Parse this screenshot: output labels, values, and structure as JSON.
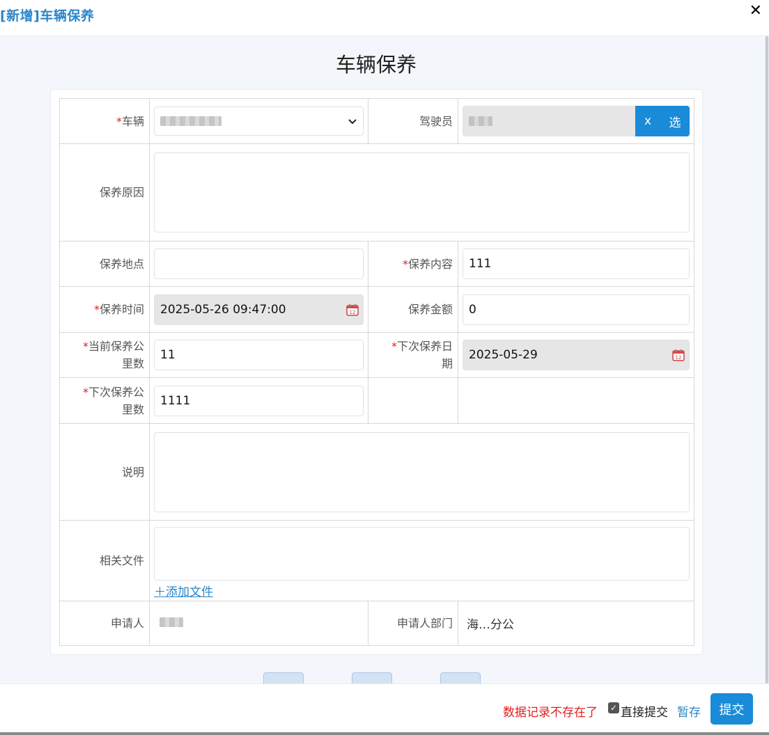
{
  "dialog": {
    "title": "[新增]车辆保养",
    "close_glyph": "✕"
  },
  "form": {
    "heading": "车辆保养",
    "required_mark": "*",
    "labels": {
      "vehicle": "车辆",
      "driver": "驾驶员",
      "reason": "保养原因",
      "location": "保养地点",
      "content": "保养内容",
      "time": "保养时间",
      "amount": "保养金额",
      "current_km_1": "当前保养公",
      "current_km_2": "里数",
      "next_date_1": "下次保养日",
      "next_date_2": "期",
      "next_km_1": "下次保养公",
      "next_km_2": "里数",
      "note": "说明",
      "files": "相关文件",
      "applicant": "申请人",
      "applicant_dept": "申请人部门"
    },
    "values": {
      "content": "111",
      "time": "2025-05-26 09:47:00",
      "amount": "0",
      "current_km": "11",
      "next_date": "2025-05-29",
      "next_km": "1111",
      "applicant_dept": "海…分公"
    },
    "buttons": {
      "clear": "x",
      "select": "选",
      "add_file": "＋添加文件"
    }
  },
  "footer": {
    "message": "数据记录不存在了",
    "direct_submit_label": "直接提交",
    "direct_submit_checked": true,
    "draft": "暂存",
    "submit": "提交"
  },
  "colors": {
    "accent": "#1a8bd8",
    "title": "#2b86c9",
    "required": "#e02020",
    "error": "#e02020"
  }
}
